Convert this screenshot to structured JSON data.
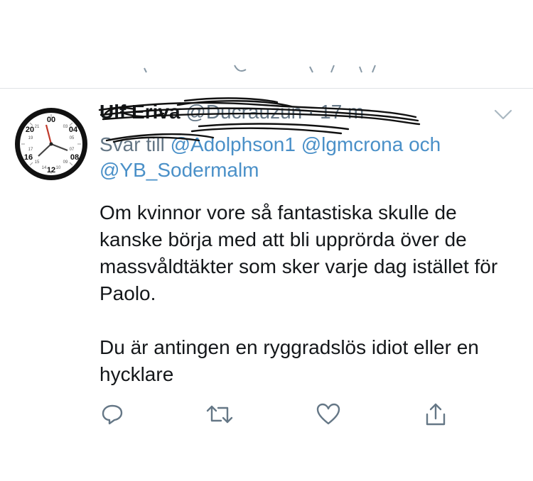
{
  "tweet": {
    "author_name": "Ulf Eriva",
    "author_handle": "@Ducrauzun",
    "time_ago": "· 17 m",
    "reply_prefix": "Svar till",
    "reply_mention_1": "@Adolphson1",
    "reply_mention_2": "@lgmcrona",
    "reply_and": "och",
    "reply_mention_3": "@YB_Sodermalm",
    "body": "Om kvinnor vore så fantastiska skulle de kanske börja med att bli upprörda över de massvåldtäkter som sker varje dag istället för Paolo.\n\nDu är antingen en ryggradslös idiot eller en hycklare"
  },
  "icons": {
    "avatar": "clock-avatar-icon",
    "menu": "chevron-down-icon",
    "reply": "reply-icon",
    "retweet": "retweet-icon",
    "like": "heart-icon",
    "share": "share-icon"
  },
  "colors": {
    "mention": "#4a90c8",
    "secondary": "#657786",
    "icon": "#657786",
    "divider": "#dfe3e6"
  }
}
